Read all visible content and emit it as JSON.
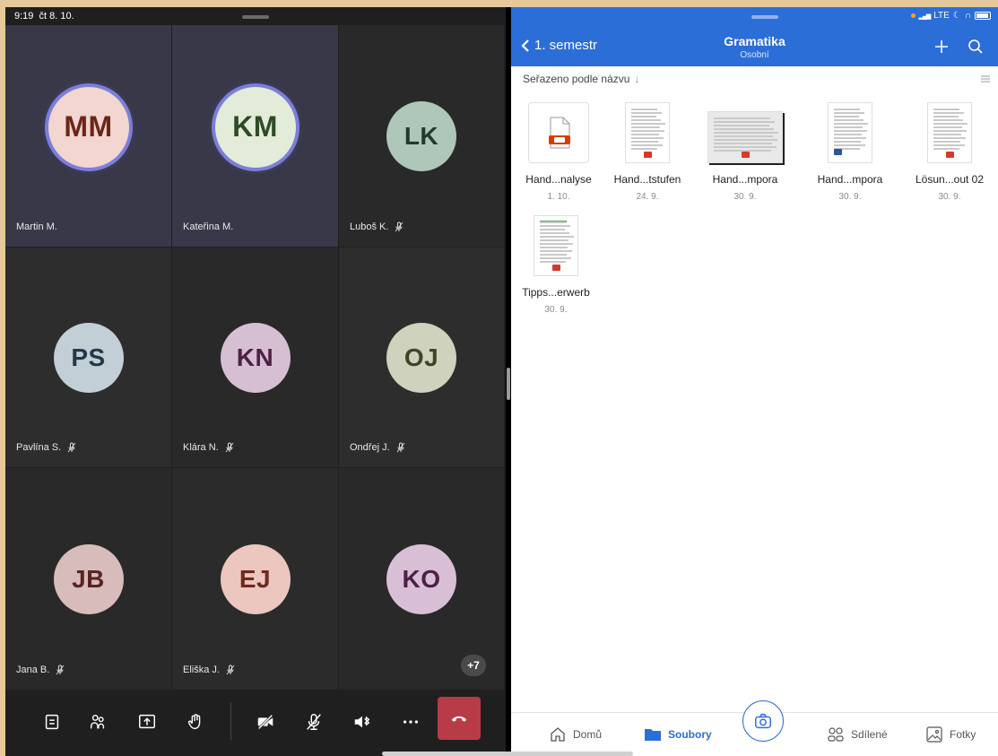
{
  "status_bar": {
    "time": "9:19",
    "date": "čt 8. 10.",
    "network": "LTE"
  },
  "teams": {
    "participants": [
      {
        "initials": "MM",
        "name": "Martin M.",
        "muted": false,
        "bg": "#393848",
        "avatar_bg": "#f2d6cf",
        "avatar_fg": "#6b2619",
        "speaking": true
      },
      {
        "initials": "KM",
        "name": "Kateřina M.",
        "muted": false,
        "bg": "#393848",
        "avatar_bg": "#e3ecd9",
        "avatar_fg": "#2f4a26",
        "speaking": true
      },
      {
        "initials": "LK",
        "name": "Luboš K.",
        "muted": true,
        "bg": "#292929",
        "avatar_bg": "#aec7b8",
        "avatar_fg": "#1f3b2e",
        "speaking": false
      },
      {
        "initials": "PS",
        "name": "Pavlína S.",
        "muted": true,
        "bg": "#2d2d2d",
        "avatar_bg": "#c3cfd6",
        "avatar_fg": "#24384a",
        "speaking": false
      },
      {
        "initials": "KN",
        "name": "Klára N.",
        "muted": true,
        "bg": "#292929",
        "avatar_bg": "#d6bfd2",
        "avatar_fg": "#4d2145",
        "speaking": false
      },
      {
        "initials": "OJ",
        "name": "Ondřej J.",
        "muted": true,
        "bg": "#2d2d2d",
        "avatar_bg": "#cfd3bd",
        "avatar_fg": "#3f4526",
        "speaking": false
      },
      {
        "initials": "JB",
        "name": "Jana B.",
        "muted": true,
        "bg": "#292929",
        "avatar_bg": "#d8bcbc",
        "avatar_fg": "#5a2424",
        "speaking": false
      },
      {
        "initials": "EJ",
        "name": "Eliška J.",
        "muted": true,
        "bg": "#2b2b2b",
        "avatar_bg": "#ebc7c0",
        "avatar_fg": "#6e2a1e",
        "speaking": false
      },
      {
        "initials": "KO",
        "name": "",
        "muted": false,
        "bg": "#292929",
        "avatar_bg": "#d9bfd6",
        "avatar_fg": "#4d2047",
        "speaking": false
      }
    ],
    "more_count": "+7",
    "hangup_color": "#b83b48"
  },
  "onedrive": {
    "back_label": "1. semestr",
    "title": "Gramatika",
    "subtitle": "Osobní",
    "sort_label": "Seřazeno podle názvu",
    "sort_arrow": "↓",
    "accent": "#2c6ed8",
    "files": [
      {
        "name": "Hand...nalyse",
        "date": "1. 10.",
        "kind": "pdf-icon"
      },
      {
        "name": "Hand...tstufen",
        "date": "24. 9.",
        "kind": "doc"
      },
      {
        "name": "Hand...mpora",
        "date": "30. 9.",
        "kind": "scan"
      },
      {
        "name": "Hand...mpora",
        "date": "30. 9.",
        "kind": "word"
      },
      {
        "name": "Lösun...out 02",
        "date": "30. 9.",
        "kind": "doc"
      },
      {
        "name": "Tipps...erwerb",
        "date": "30. 9.",
        "kind": "doc-green"
      }
    ],
    "tabs": [
      {
        "label": "Domů",
        "icon": "home-icon",
        "active": false
      },
      {
        "label": "Soubory",
        "icon": "folder-icon",
        "active": true
      },
      {
        "label": "Sdílené",
        "icon": "people-icon",
        "active": false
      },
      {
        "label": "Fotky",
        "icon": "photo-icon",
        "active": false
      }
    ]
  }
}
